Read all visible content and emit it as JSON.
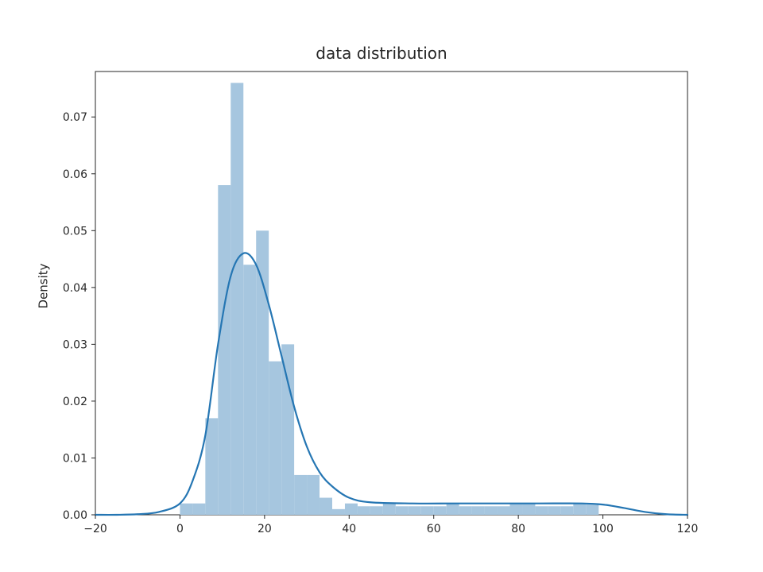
{
  "chart_data": {
    "type": "hist+kde",
    "title": "data distribution",
    "xlabel": "",
    "ylabel": "Density",
    "xlim": [
      -20,
      120
    ],
    "ylim": [
      0,
      0.078
    ],
    "xticks": [
      -20,
      0,
      20,
      40,
      60,
      80,
      100,
      120
    ],
    "yticks": [
      0.0,
      0.01,
      0.02,
      0.03,
      0.04,
      0.05,
      0.06,
      0.07
    ],
    "xtick_labels": [
      "−20",
      "0",
      "20",
      "40",
      "60",
      "80",
      "100",
      "120"
    ],
    "ytick_labels": [
      "0.00",
      "0.01",
      "0.02",
      "0.03",
      "0.04",
      "0.05",
      "0.06",
      "0.07"
    ],
    "histogram": {
      "bin_width": 3,
      "bins": [
        {
          "x0": 0,
          "x1": 3,
          "density": 0.002
        },
        {
          "x0": 3,
          "x1": 6,
          "density": 0.002
        },
        {
          "x0": 6,
          "x1": 9,
          "density": 0.017
        },
        {
          "x0": 9,
          "x1": 12,
          "density": 0.058
        },
        {
          "x0": 12,
          "x1": 15,
          "density": 0.076
        },
        {
          "x0": 15,
          "x1": 18,
          "density": 0.044
        },
        {
          "x0": 18,
          "x1": 21,
          "density": 0.05
        },
        {
          "x0": 21,
          "x1": 24,
          "density": 0.027
        },
        {
          "x0": 24,
          "x1": 27,
          "density": 0.03
        },
        {
          "x0": 27,
          "x1": 30,
          "density": 0.007
        },
        {
          "x0": 30,
          "x1": 33,
          "density": 0.007
        },
        {
          "x0": 33,
          "x1": 36,
          "density": 0.003
        },
        {
          "x0": 36,
          "x1": 39,
          "density": 0.001
        },
        {
          "x0": 39,
          "x1": 42,
          "density": 0.002
        },
        {
          "x0": 42,
          "x1": 45,
          "density": 0.0015
        },
        {
          "x0": 45,
          "x1": 48,
          "density": 0.0015
        },
        {
          "x0": 48,
          "x1": 51,
          "density": 0.002
        },
        {
          "x0": 51,
          "x1": 54,
          "density": 0.0015
        },
        {
          "x0": 54,
          "x1": 57,
          "density": 0.0015
        },
        {
          "x0": 57,
          "x1": 60,
          "density": 0.0015
        },
        {
          "x0": 60,
          "x1": 63,
          "density": 0.0015
        },
        {
          "x0": 63,
          "x1": 66,
          "density": 0.002
        },
        {
          "x0": 66,
          "x1": 69,
          "density": 0.0015
        },
        {
          "x0": 69,
          "x1": 72,
          "density": 0.0015
        },
        {
          "x0": 72,
          "x1": 75,
          "density": 0.0015
        },
        {
          "x0": 75,
          "x1": 78,
          "density": 0.0015
        },
        {
          "x0": 78,
          "x1": 81,
          "density": 0.002
        },
        {
          "x0": 81,
          "x1": 84,
          "density": 0.002
        },
        {
          "x0": 84,
          "x1": 87,
          "density": 0.0015
        },
        {
          "x0": 87,
          "x1": 90,
          "density": 0.0015
        },
        {
          "x0": 90,
          "x1": 93,
          "density": 0.0015
        },
        {
          "x0": 93,
          "x1": 96,
          "density": 0.002
        },
        {
          "x0": 96,
          "x1": 99,
          "density": 0.002
        }
      ]
    },
    "kde": {
      "x": [
        -20,
        -15,
        -10,
        -5,
        0,
        3,
        6,
        9,
        12,
        15,
        18,
        21,
        24,
        27,
        30,
        33,
        36,
        40,
        45,
        55,
        65,
        75,
        85,
        95,
        100,
        105,
        110,
        115,
        120
      ],
      "density": [
        0.0,
        0.0,
        0.0001,
        0.0005,
        0.002,
        0.006,
        0.014,
        0.03,
        0.042,
        0.046,
        0.044,
        0.037,
        0.028,
        0.019,
        0.012,
        0.0075,
        0.005,
        0.003,
        0.0022,
        0.002,
        0.002,
        0.002,
        0.002,
        0.002,
        0.0018,
        0.0012,
        0.0005,
        0.0001,
        0.0
      ]
    },
    "colors": {
      "bar_fill": "#a6c6df",
      "line": "#2576b3"
    }
  }
}
